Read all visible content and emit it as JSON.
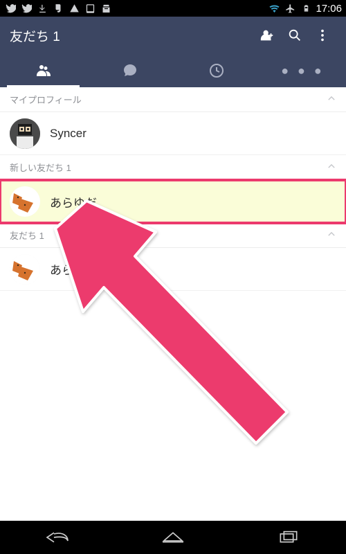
{
  "statusbar": {
    "time": "17:06"
  },
  "header": {
    "title": "友だち 1"
  },
  "tabs": {
    "items": [
      {
        "id": "friends",
        "active": true
      },
      {
        "id": "chats",
        "active": false
      },
      {
        "id": "timeline",
        "active": false
      },
      {
        "id": "more",
        "active": false
      }
    ]
  },
  "sections": {
    "profile": {
      "label": "マイプロフィール",
      "name": "Syncer"
    },
    "new": {
      "label": "新しい友だち 1",
      "name": "あらゆだ"
    },
    "friends": {
      "label": "友だち 1",
      "name": "あらゆだ"
    }
  },
  "colors": {
    "appbar_bg": "#3c4662",
    "highlight_outline": "#ec3a6d",
    "highlight_fill": "#fafdd8",
    "arrow": "#ec3a6d"
  }
}
